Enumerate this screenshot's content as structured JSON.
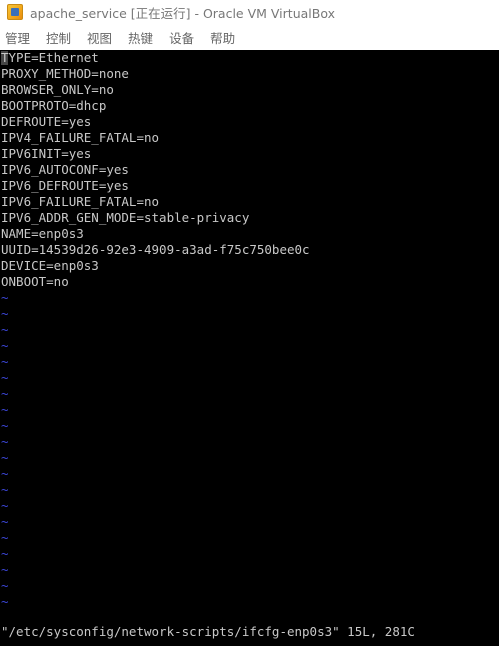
{
  "window": {
    "title": "apache_service [正在运行] - Oracle VM VirtualBox",
    "icon": "virtualbox-icon"
  },
  "menu": {
    "items": [
      "管理",
      "控制",
      "视图",
      "热键",
      "设备",
      "帮助"
    ]
  },
  "editor": {
    "lines": [
      "TYPE=Ethernet",
      "PROXY_METHOD=none",
      "BROWSER_ONLY=no",
      "BOOTPROTO=dhcp",
      "DEFROUTE=yes",
      "IPV4_FAILURE_FATAL=no",
      "IPV6INIT=yes",
      "IPV6_AUTOCONF=yes",
      "IPV6_DEFROUTE=yes",
      "IPV6_FAILURE_FATAL=no",
      "IPV6_ADDR_GEN_MODE=stable-privacy",
      "NAME=enp0s3",
      "UUID=14539d26-92e3-4909-a3ad-f75c750bee0c",
      "DEVICE=enp0s3",
      "ONBOOT=no"
    ],
    "empty_line_marker": "~",
    "empty_line_count": 20,
    "status": "\"/etc/sysconfig/network-scripts/ifcfg-enp0s3\" 15L, 281C",
    "colors": {
      "background": "#000000",
      "text": "#c8c8c8",
      "tilde": "#3b45d6"
    }
  }
}
